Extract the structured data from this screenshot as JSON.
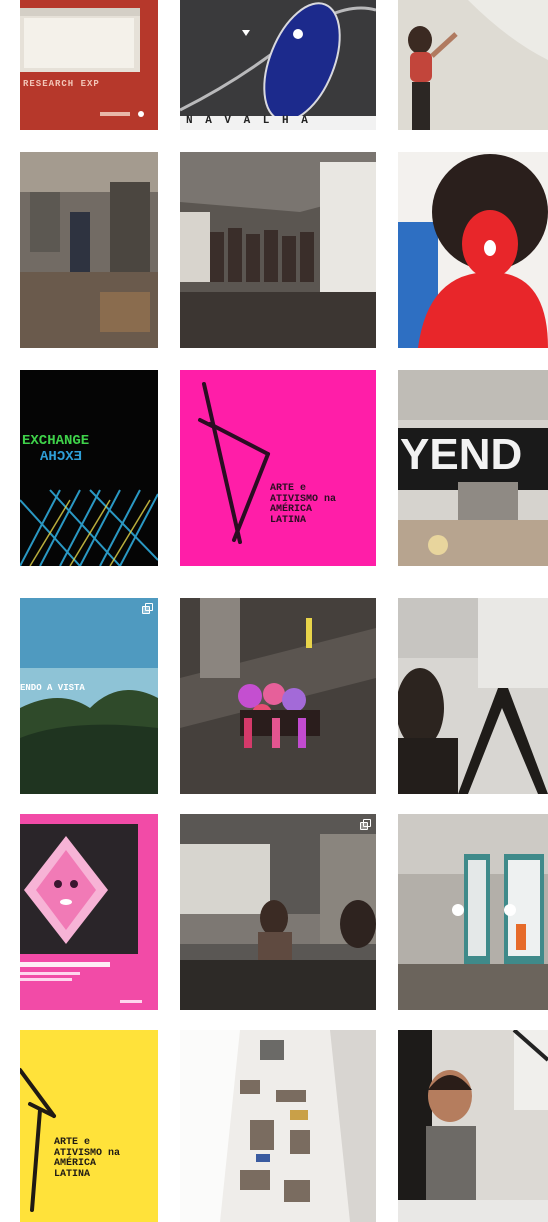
{
  "grid": {
    "tiles": [
      {
        "id": "r1c1",
        "overlay_text": "RESEARCH EXP"
      },
      {
        "id": "r1c2",
        "overlay_text": "N A V A L H A"
      },
      {
        "id": "r1c3"
      },
      {
        "id": "r2c1"
      },
      {
        "id": "r2c2"
      },
      {
        "id": "r2c3"
      },
      {
        "id": "r3c1",
        "overlay_text": "EXCHANGE",
        "overlay_text_mirrored": "EXCHA"
      },
      {
        "id": "r3c2",
        "overlay_lines": [
          "ARTE e",
          "ATIVISMO na",
          "AMÉRICA",
          "LATINA"
        ]
      },
      {
        "id": "r3c3",
        "overlay_text": "YEND"
      },
      {
        "id": "r4c1",
        "overlay_text": "ENDO A VISTA",
        "multi": true
      },
      {
        "id": "r4c2"
      },
      {
        "id": "r4c3"
      },
      {
        "id": "r5c1"
      },
      {
        "id": "r5c2",
        "multi": true
      },
      {
        "id": "r5c3"
      },
      {
        "id": "r6c1",
        "overlay_lines": [
          "ARTE e",
          "ATIVISMO na",
          "AMÉRICA",
          "LATINA"
        ]
      },
      {
        "id": "r6c2"
      },
      {
        "id": "r6c3"
      }
    ]
  },
  "colors": {
    "magenta": "#ff1ea8",
    "yellow": "#ffe23a",
    "brick": "#b23a2c",
    "navy": "#1f2a8a",
    "green": "#3fd24a",
    "red": "#e8262a"
  }
}
